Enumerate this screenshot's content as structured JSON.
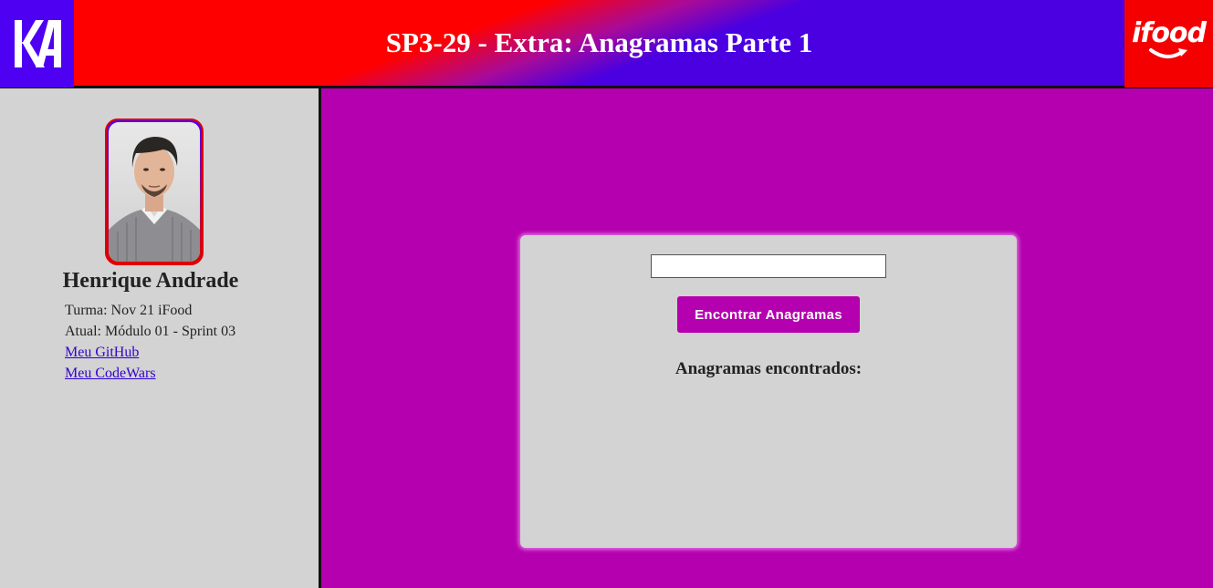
{
  "header": {
    "title": "SP3-29 - Extra: Anagramas Parte 1",
    "logo_right_text": "ifood",
    "colors": {
      "red": "#ff0000",
      "purple": "#4a00e0"
    }
  },
  "profile": {
    "name": "Henrique Andrade",
    "turma": "Turma: Nov 21 iFood",
    "atual": "Atual: Módulo 01 - Sprint 03",
    "github_link": "Meu GitHub",
    "codewars_link": "Meu CodeWars"
  },
  "main": {
    "input_value": "",
    "button_label": "Encontrar Anagramas",
    "results_title": "Anagramas encontrados:",
    "accent": "#b400ae"
  }
}
